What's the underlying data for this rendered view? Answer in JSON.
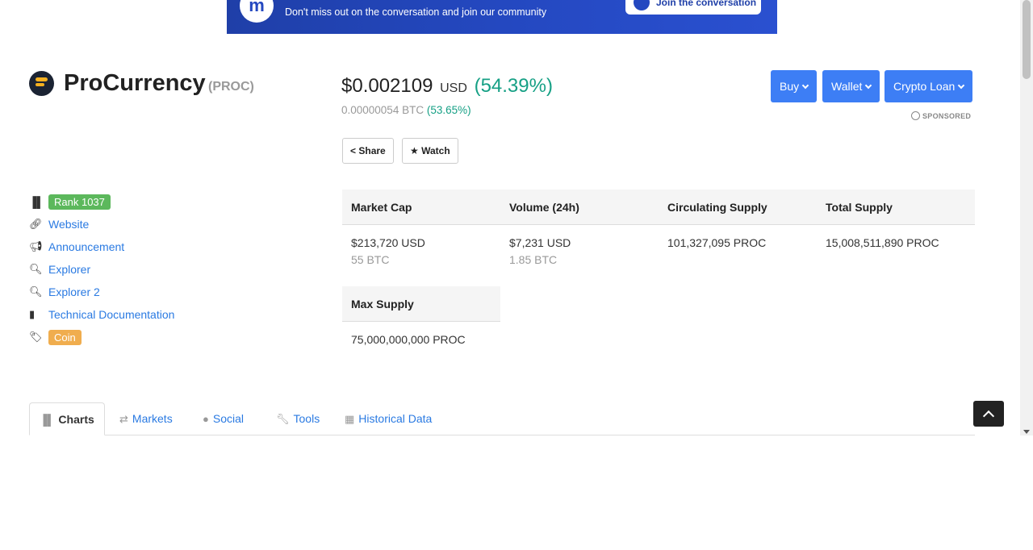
{
  "banner": {
    "text": "Don't miss out on the conversation and join our community",
    "button": "Join the conversation"
  },
  "coin": {
    "name": "ProCurrency",
    "symbol": "(PROC)"
  },
  "price": {
    "usd": "$0.002109",
    "currency": "USD",
    "change": "(54.39%)",
    "btc": "0.00000054 BTC",
    "btc_change": "(53.65%)"
  },
  "actions": {
    "share": "Share",
    "watch": "Watch"
  },
  "top_buttons": {
    "buy": "Buy",
    "wallet": "Wallet",
    "loan": "Crypto Loan",
    "sponsored": "SPONSORED"
  },
  "links": {
    "rank": "Rank 1037",
    "website": "Website",
    "announcement": "Announcement",
    "explorer": "Explorer",
    "explorer2": "Explorer 2",
    "docs": "Technical Documentation",
    "tag": "Coin"
  },
  "stats": {
    "headers": [
      "Market Cap",
      "Volume (24h)",
      "Circulating Supply",
      "Total Supply"
    ],
    "market_cap_usd": "$213,720 USD",
    "market_cap_btc": "55 BTC",
    "volume_usd": "$7,231 USD",
    "volume_btc": "1.85 BTC",
    "circulating": "101,327,095 PROC",
    "total": "15,008,511,890 PROC",
    "max_header": "Max Supply",
    "max": "75,000,000,000 PROC"
  },
  "tabs": [
    "Charts",
    "Markets",
    "Social",
    "Tools",
    "Historical Data"
  ],
  "colors": {
    "accent": "#3d7ef5",
    "positive": "#16a085",
    "link": "#2a7ae2",
    "rank_badge": "#5cb85c",
    "coin_badge": "#f0ad4e"
  }
}
